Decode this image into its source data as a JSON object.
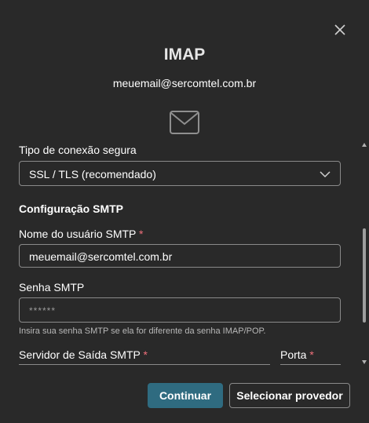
{
  "dialog": {
    "title": "IMAP",
    "email": "meuemail@sercomtel.com.br",
    "close_icon": "close-icon",
    "mail_icon": "mail-icon"
  },
  "form": {
    "connection_type": {
      "label": "Tipo de conexão segura",
      "value": "SSL / TLS (recomendado)"
    },
    "smtp_section_title": "Configuração SMTP",
    "smtp_username": {
      "label": "Nome do usuário SMTP",
      "required_mark": "*",
      "value": "meuemail@sercomtel.com.br"
    },
    "smtp_password": {
      "label": "Senha SMTP",
      "placeholder": "******",
      "hint": "Insira sua senha SMTP se ela for diferente da senha IMAP/POP."
    },
    "smtp_server": {
      "label": "Servidor de Saída SMTP",
      "required_mark": "*"
    },
    "port": {
      "label": "Porta",
      "required_mark": "*"
    }
  },
  "buttons": {
    "continue": "Continuar",
    "select_provider": "Selecionar provedor"
  },
  "colors": {
    "background": "#292929",
    "primary_button": "#2f6b80",
    "required": "#f1707b",
    "border": "#8a8a8a"
  }
}
